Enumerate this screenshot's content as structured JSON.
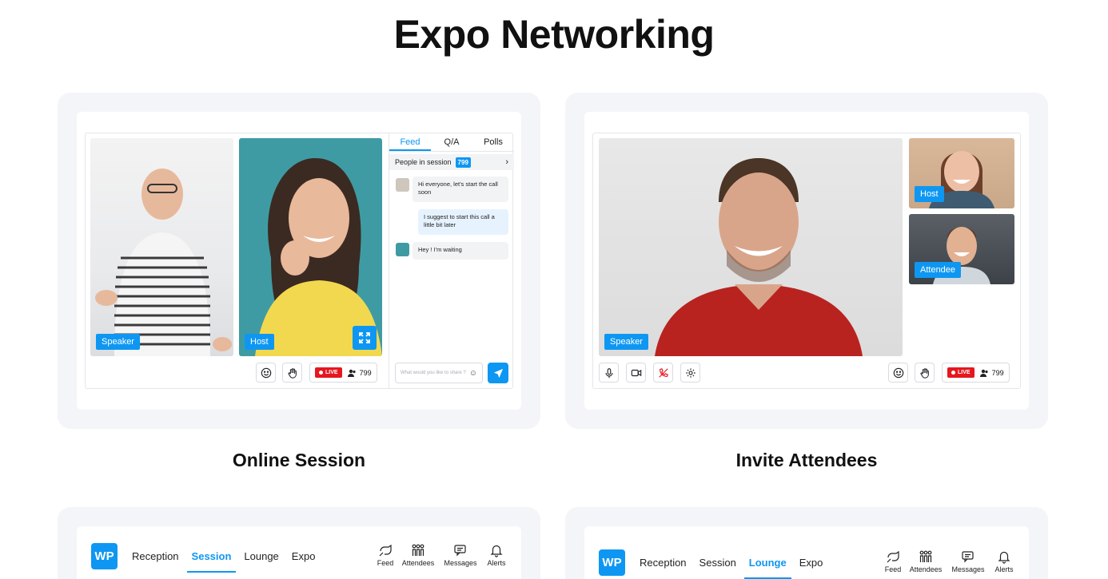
{
  "page": {
    "title": "Expo Networking"
  },
  "cards": [
    {
      "caption": "Online Session",
      "tags": {
        "speaker": "Speaker",
        "host": "Host"
      },
      "chat": {
        "tabs": [
          "Feed",
          "Q/A",
          "Polls"
        ],
        "active_tab": "Feed",
        "people_label": "People in session",
        "people_count": "799",
        "messages": [
          {
            "text": "Hi everyone, let's start the call soon",
            "side": "in"
          },
          {
            "text": "I suggest to start this call a little bit later",
            "side": "out"
          },
          {
            "text": "Hey ! I'm waiting",
            "side": "in"
          }
        ],
        "input_placeholder": "What would you like to share ?"
      },
      "controls": {
        "live_label": "LIVE",
        "viewer_count": "799"
      }
    },
    {
      "caption": "Invite Attendees",
      "tags": {
        "speaker": "Speaker",
        "host": "Host",
        "attendee": "Attendee"
      },
      "controls": {
        "live_label": "LIVE",
        "viewer_count": "799"
      }
    }
  ],
  "navbars": [
    {
      "logo": "WP",
      "links": [
        "Reception",
        "Session",
        "Lounge",
        "Expo"
      ],
      "active": "Session",
      "icons": [
        {
          "label": "Feed",
          "icon": "feed-icon"
        },
        {
          "label": "Attendees",
          "icon": "attendees-icon"
        },
        {
          "label": "Messages",
          "icon": "messages-icon"
        },
        {
          "label": "Alerts",
          "icon": "bell-icon"
        }
      ]
    },
    {
      "logo": "WP",
      "links": [
        "Reception",
        "Session",
        "Lounge",
        "Expo"
      ],
      "active": "Lounge",
      "icons": [
        {
          "label": "Feed",
          "icon": "feed-icon"
        },
        {
          "label": "Attendees",
          "icon": "attendees-icon"
        },
        {
          "label": "Messages",
          "icon": "messages-icon"
        },
        {
          "label": "Alerts",
          "icon": "bell-icon"
        }
      ]
    }
  ],
  "colors": {
    "accent": "#0e97f2",
    "live": "#e5171f",
    "card_bg": "#f4f5f8"
  }
}
